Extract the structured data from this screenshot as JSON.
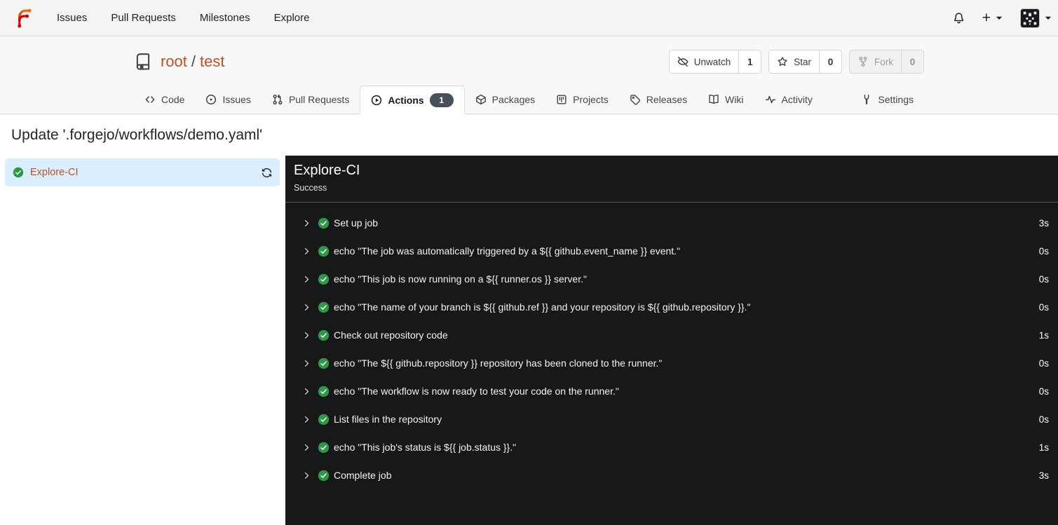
{
  "navbar": {
    "items": [
      "Issues",
      "Pull Requests",
      "Milestones",
      "Explore"
    ],
    "plus": "+"
  },
  "repo": {
    "owner": "root",
    "sep": "/",
    "name": "test",
    "buttons": {
      "unwatch": {
        "label": "Unwatch",
        "count": "1"
      },
      "star": {
        "label": "Star",
        "count": "0"
      },
      "fork": {
        "label": "Fork",
        "count": "0"
      }
    }
  },
  "tabs": {
    "code": "Code",
    "issues": "Issues",
    "pulls": "Pull Requests",
    "actions": "Actions",
    "actions_badge": "1",
    "packages": "Packages",
    "projects": "Projects",
    "releases": "Releases",
    "wiki": "Wiki",
    "activity": "Activity",
    "settings": "Settings"
  },
  "run": {
    "title": "Update '.forgejo/workflows/demo.yaml'"
  },
  "sidebar": {
    "job": "Explore-CI"
  },
  "panel": {
    "title": "Explore-CI",
    "status": "Success",
    "steps": [
      {
        "name": "Set up job",
        "duration": "3s"
      },
      {
        "name": "echo \"The job was automatically triggered by a ${{ github.event_name }} event.\"",
        "duration": "0s"
      },
      {
        "name": "echo \"This job is now running on a ${{ runner.os }} server.\"",
        "duration": "0s"
      },
      {
        "name": "echo \"The name of your branch is ${{ github.ref }} and your repository is ${{ github.repository }}.\"",
        "duration": "0s"
      },
      {
        "name": "Check out repository code",
        "duration": "1s"
      },
      {
        "name": "echo \"The ${{ github.repository }} repository has been cloned to the runner.\"",
        "duration": "0s"
      },
      {
        "name": "echo \"The workflow is now ready to test your code on the runner.\"",
        "duration": "0s"
      },
      {
        "name": "List files in the repository",
        "duration": "0s"
      },
      {
        "name": "echo \"This job's status is ${{ job.status }}.\"",
        "duration": "1s"
      },
      {
        "name": "Complete job",
        "duration": "3s"
      }
    ]
  },
  "colors": {
    "accent": "#c14e26",
    "success_green": "#2c9a44",
    "selected_job_bg": "#d9eefe",
    "panel_bg": "#17181a",
    "badge_bg": "#475059"
  }
}
